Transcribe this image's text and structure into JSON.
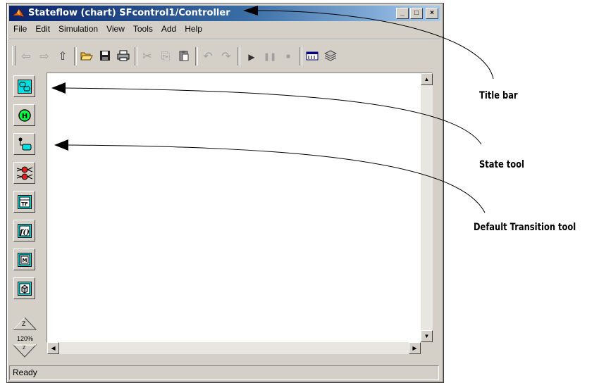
{
  "window": {
    "title": "Stateflow (chart) SFcontrol1/Controller",
    "controls": {
      "minimize": "_",
      "maximize": "□",
      "close": "×"
    }
  },
  "menubar": [
    "File",
    "Edit",
    "Simulation",
    "View",
    "Tools",
    "Add",
    "Help"
  ],
  "toolbar": {
    "icons": [
      "back-arrow-icon",
      "forward-arrow-icon",
      "up-arrow-icon",
      "open-folder-icon",
      "save-icon",
      "print-icon",
      "cut-icon",
      "copy-icon",
      "paste-icon",
      "undo-icon",
      "redo-icon",
      "play-icon",
      "pause-icon",
      "stop-icon",
      "explorer-icon",
      "debugger-icon"
    ]
  },
  "palette": {
    "tools": [
      "state-tool",
      "history-junction-tool",
      "default-transition-tool",
      "connective-junction-tool",
      "truth-table-tool",
      "graphical-function-tool",
      "embedded-matlab-tool",
      "box-tool"
    ],
    "zoom": "120%",
    "zoom_in": "Z",
    "zoom_out": "Z"
  },
  "status": {
    "text": "Ready"
  },
  "annotations": {
    "title_bar": "Title bar",
    "state_tool": "State tool",
    "default_transition_tool": "Default Transition tool"
  },
  "colors": {
    "title_start": "#0a246a",
    "title_end": "#a6caf0",
    "tool_fill": "#00e0e0",
    "chrome": "#d4d0c8"
  }
}
